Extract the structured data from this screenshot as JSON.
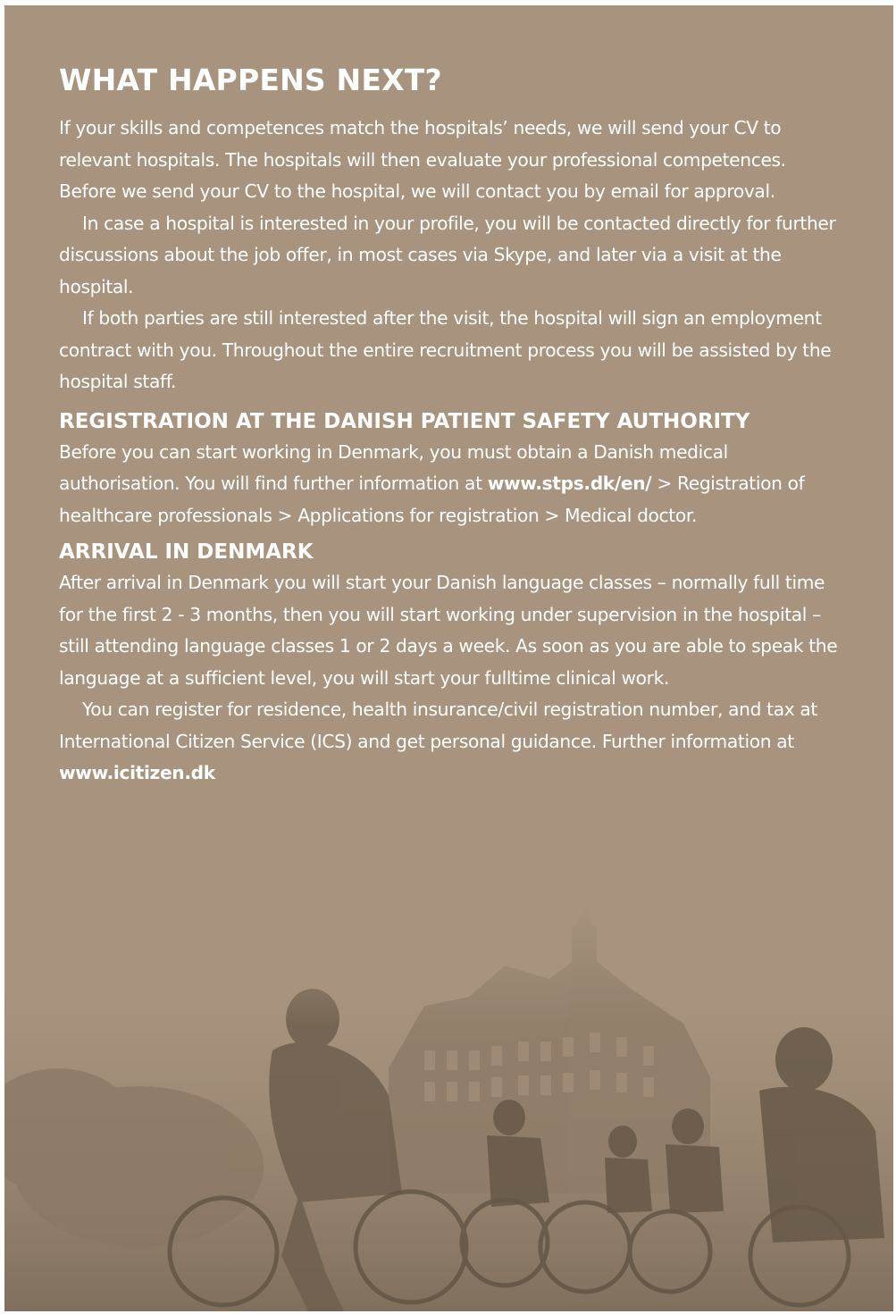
{
  "heading": "WHAT HAPPENS NEXT?",
  "intro": {
    "p1": "If your skills and competences match the hospitals’ needs, we will send your CV to relevant hospitals. The hospitals will then evaluate your professional competences. Before we send your CV to the hospital, we will contact you by email for approval.",
    "p2": "In case a hospital is interested in your profile, you will be contacted directly for further discussions about the job offer, in most cases via Skype,  and later via a visit at the hospital.",
    "p3": "If both parties are still interested after the visit, the hospital will sign an employment contract with you. Throughout the entire recruitment process you will be assisted by the hospital staff."
  },
  "registration": {
    "title": "REGISTRATION AT THE DANISH PATIENT SAFETY AUTHORITY",
    "text_before": "Before you can start working in Denmark, you must obtain a Danish medical authorisation. You will find further information at ",
    "link": "www.stps.dk/en/",
    "text_after": " > Registration of healthcare professionals > Applications for registration > Medical doctor."
  },
  "arrival": {
    "title": "ARRIVAL IN DENMARK",
    "p1": "After arrival in Denmark you will start your Danish language classes – normally full time for the first 2 - 3 months, then you will start working under supervision in the hospital – still attending language classes 1 or 2 days a week. As soon as you are able to speak the language at a sufficient level, you will start your fulltime clinical work.",
    "p2_before": "You can register for residence, health insurance/civil registration number, and tax at International Citizen Service (ICS) and get personal guidance. Further information at ",
    "link": "www.icitizen.dk"
  },
  "colors": {
    "background": "#a8947e",
    "text": "#ffffff"
  },
  "photo": {
    "icon": "cyclists-city-street-photo"
  }
}
